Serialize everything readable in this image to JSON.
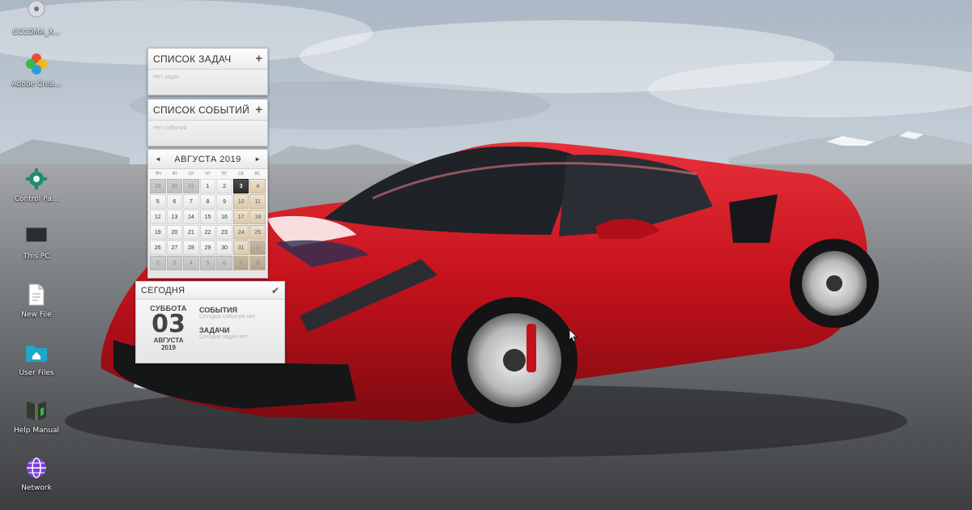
{
  "desktop_icons": [
    {
      "label": "CCCOMA_X...",
      "icon": "disc-icon"
    },
    {
      "label": "Adobe Crea...",
      "icon": "adobe-icon"
    },
    {
      "label": "Control Pa...",
      "icon": "control-panel-icon"
    },
    {
      "label": "This PC",
      "icon": "monitor-icon"
    },
    {
      "label": "New File",
      "icon": "file-icon"
    },
    {
      "label": "User Files",
      "icon": "home-folder-icon"
    },
    {
      "label": "Help Manual",
      "icon": "help-manual-icon"
    },
    {
      "label": "Network",
      "icon": "network-icon"
    }
  ],
  "tasks_gadget": {
    "title": "СПИСОК ЗАДАЧ",
    "add": "+",
    "empty": "Нет задач"
  },
  "events_gadget": {
    "title": "СПИСОК СОБЫТИЙ",
    "add": "+",
    "empty": "Нет событий"
  },
  "calendar": {
    "prev": "◄",
    "next": "►",
    "month_label": "АВГУСТА 2019",
    "weekdays": [
      "ПН",
      "ВТ",
      "СР",
      "ЧТ",
      "ПТ",
      "СБ",
      "ВС"
    ],
    "weeks": [
      [
        "29",
        "30",
        "31",
        "1",
        "2",
        "3",
        "4"
      ],
      [
        "5",
        "6",
        "7",
        "8",
        "9",
        "10",
        "11"
      ],
      [
        "12",
        "13",
        "14",
        "15",
        "16",
        "17",
        "18"
      ],
      [
        "19",
        "20",
        "21",
        "22",
        "23",
        "24",
        "25"
      ],
      [
        "26",
        "27",
        "28",
        "29",
        "30",
        "31",
        "1"
      ],
      [
        "2",
        "3",
        "4",
        "5",
        "6",
        "7",
        "8"
      ]
    ],
    "today": "3"
  },
  "today_gadget": {
    "title": "СЕГОДНЯ",
    "check": "✔",
    "weekday": "СУББОТА",
    "day": "03",
    "month": "АВГУСТА",
    "year": "2019",
    "events_title": "СОБЫТИЯ",
    "events_empty": "Сегодня событий нет",
    "tasks_title": "ЗАДАЧИ",
    "tasks_empty": "Сегодня задач нет"
  },
  "colors": {
    "car_red": "#c4121c",
    "sky": "#c9d3dc",
    "ground": "#5a5d61"
  }
}
